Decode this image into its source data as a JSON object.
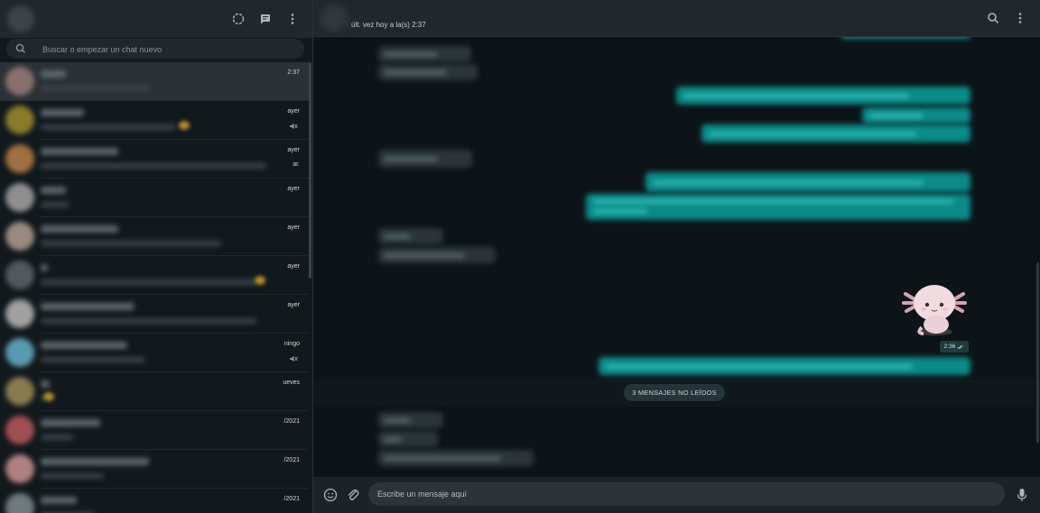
{
  "sidebar": {
    "search_placeholder": "Buscar o empezar un chat nuevo",
    "chats": [
      {
        "time": "2:37",
        "active": true,
        "avatar_color": "#8a6f6f"
      },
      {
        "time": "ayer",
        "muted": true,
        "avatar_color": "#8a7a2a"
      },
      {
        "time": "ayer",
        "time2": "ar.",
        "avatar_color": "#a07040"
      },
      {
        "time": "ayer",
        "avatar_color": "#8f8f8f"
      },
      {
        "time": "ayer",
        "avatar_color": "#9a8a80"
      },
      {
        "time": "ayer",
        "avatar_color": "#505a5e"
      },
      {
        "time": "ayer",
        "avatar_color": "#a0a0a0"
      },
      {
        "time": "ningo",
        "muted": true,
        "avatar_color": "#5a9ab0"
      },
      {
        "time": "ueves",
        "avatar_color": "#8a7a50"
      },
      {
        "time": "/2021",
        "avatar_color": "#a05050"
      },
      {
        "time": "/2021",
        "avatar_color": "#b08080"
      },
      {
        "time": "/2021",
        "avatar_color": "#707a7e"
      }
    ]
  },
  "chat": {
    "last_seen": "últ. vez hoy a la(s) 2:37",
    "sticker_time": "2:36",
    "unread_label": "3 MENSAJES NO LEÍDOS",
    "composer_placeholder": "Escribe un mensaje aquí"
  },
  "colors": {
    "accent_outgoing": "#0b8a87",
    "incoming": "#2b3539",
    "background": "#0d1418"
  },
  "icons": {
    "status": "status-icon",
    "new_chat": "new-chat-icon",
    "menu": "menu-icon",
    "search": "search-icon",
    "emoji": "emoji-icon",
    "attach": "attach-icon",
    "mic": "mic-icon"
  }
}
